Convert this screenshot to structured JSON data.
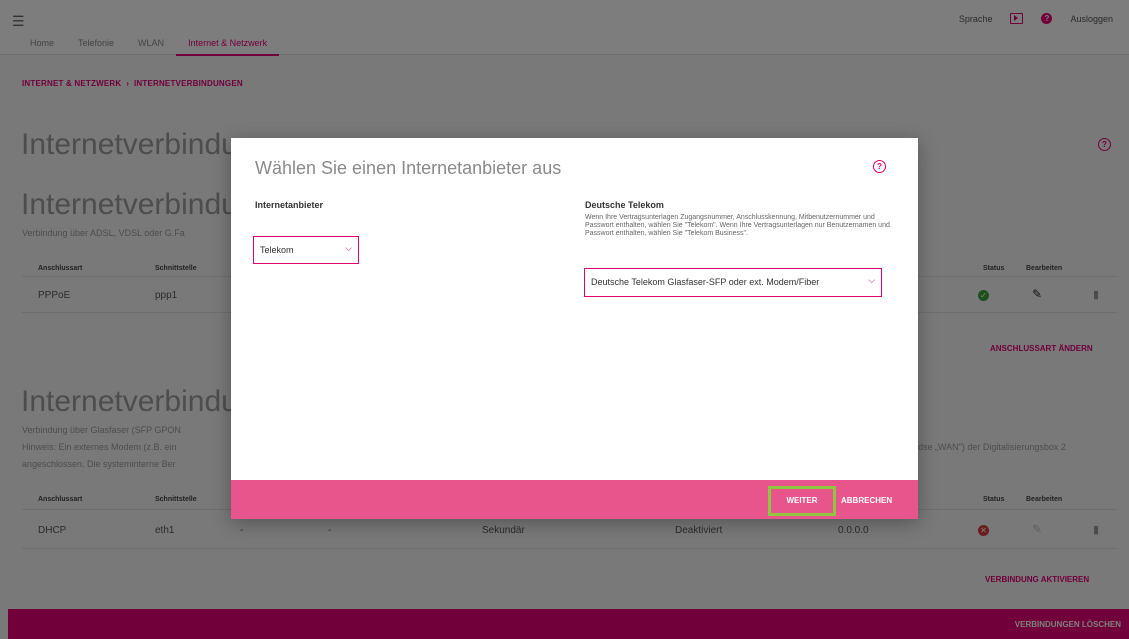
{
  "header": {
    "tabs": [
      {
        "label": "Home"
      },
      {
        "label": "Telefonie"
      },
      {
        "label": "WLAN"
      },
      {
        "label": "Internet & Netzwerk"
      }
    ],
    "language_label": "Sprache",
    "logout_label": "Ausloggen"
  },
  "breadcrumb": {
    "root": "INTERNET & NETZWERK",
    "separator": "›",
    "current": "INTERNETVERBINDUNGEN"
  },
  "page": {
    "title": "Internetverbindungen",
    "section1_title": "Internetverbindung",
    "section1_desc": "Verbindung über ADSL, VDSL oder G.Fa",
    "section2_title": "Internetverbindung",
    "section2_desc1": "Verbindung über Glasfaser (SFP GPON",
    "section2_desc2": "Hinweis: Ein externes Modem (z.B. ein",
    "section2_desc3": "angeschlossen. Die systeminterne Ber",
    "section2_desc_right": "dse „WAN\") der Digitalisierungsbox 2"
  },
  "table1": {
    "headers": {
      "type": "Anschlussart",
      "interface": "Schnittstelle",
      "status": "Status",
      "edit": "Bearbeiten"
    },
    "row": {
      "type": "PPPoE",
      "interface": "ppp1"
    },
    "change_link": "ANSCHLUSSART ÄNDERN"
  },
  "table2": {
    "headers": {
      "type": "Anschlussart",
      "interface": "Schnittstelle",
      "status": "Status",
      "edit": "Bearbeiten"
    },
    "row": {
      "type": "DHCP",
      "interface": "eth1",
      "col3": "-",
      "col4": "-",
      "role": "Sekundär",
      "state": "Deaktiviert",
      "ip": "0.0.0.0"
    },
    "activate_link": "VERBINDUNG AKTIVIEREN"
  },
  "bottom_bar": {
    "label": "VERBINDUNGEN LÖSCHEN"
  },
  "dialog": {
    "title": "Wählen Sie einen Internetanbieter aus",
    "provider_label": "Internetanbieter",
    "provider_value": "Telekom",
    "telekom_title": "Deutsche Telekom",
    "telekom_text": "Wenn Ihre Vertragsunterlagen Zugangsnummer, Anschlusskennung, Mitbenutzernummer und Passwort enthalten, wählen Sie \"Telekom\". Wenn Ihre Vertragsunterlagen nur Benutzernamen und Passwort enthalten, wählen Sie \"Telekom Business\".",
    "connection_value": "Deutsche Telekom Glasfaser-SFP oder ext. Modem/Fiber",
    "next_button": "WEITER",
    "cancel_button": "ABBRECHEN"
  },
  "colors": {
    "accent": "#e20074",
    "footer": "#e8558d",
    "highlight": "#8dc63f"
  },
  "icons": [
    "menu-icon",
    "video-icon",
    "help-icon",
    "chevron-down-icon",
    "check-icon",
    "error-icon",
    "pencil-icon",
    "trash-icon"
  ]
}
